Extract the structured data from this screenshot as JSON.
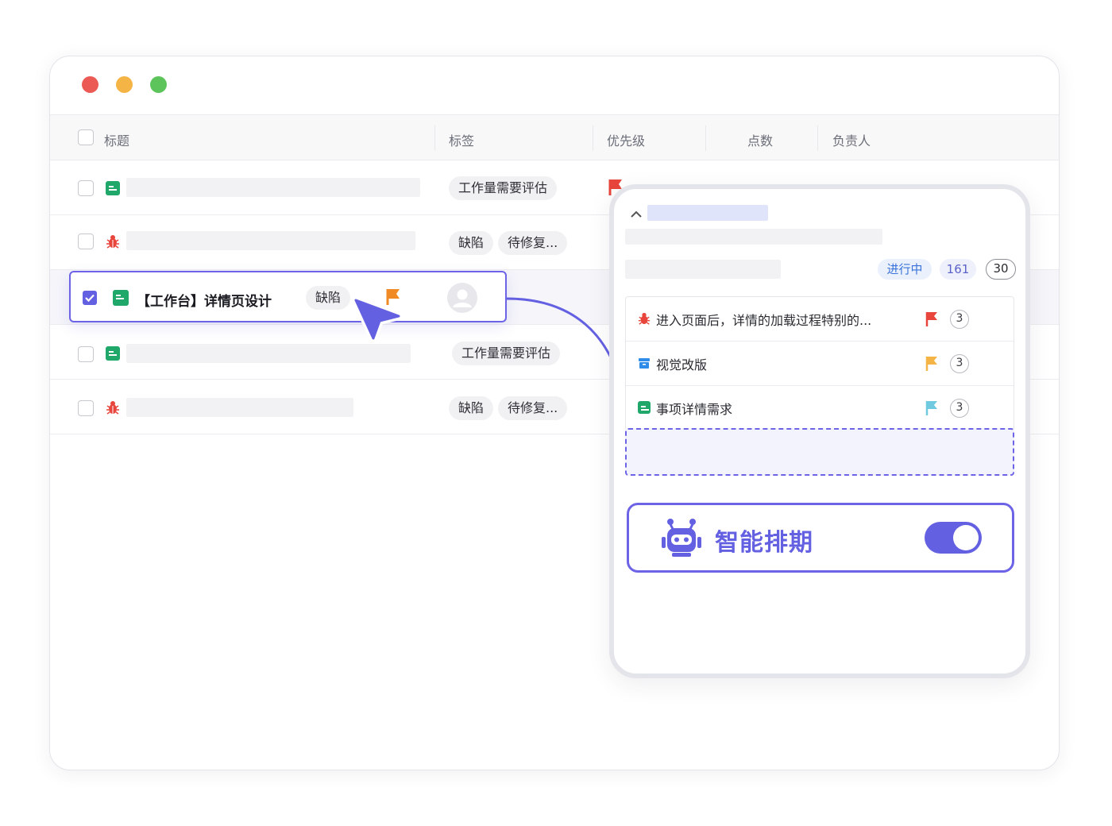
{
  "window": {
    "traffic_lights": [
      "#ec5a55",
      "#f5b546",
      "#5cc45a"
    ]
  },
  "table": {
    "columns": [
      "标题",
      "标签",
      "优先级",
      "点数",
      "负责人"
    ],
    "rows": [
      {
        "type": "doc",
        "tags": [
          "工作量需要评估"
        ]
      },
      {
        "type": "bug",
        "tags": [
          "缺陷",
          "待修复..."
        ]
      },
      {
        "type": "doc",
        "tags": [
          "工作量需要评估"
        ]
      },
      {
        "type": "bug",
        "tags": [
          "缺陷",
          "待修复..."
        ]
      }
    ]
  },
  "dragged_item": {
    "title": "【工作台】详情页设计",
    "tag": "缺陷",
    "flag_color": "#f08a24",
    "checked": true
  },
  "panel": {
    "status": "进行中",
    "count_a": "161",
    "count_b": "30",
    "items": [
      {
        "type": "bug",
        "text": "进入页面后，详情的加载过程特别的...",
        "flag_color": "#e8453c",
        "points": "3"
      },
      {
        "type": "box",
        "text": "视觉改版",
        "flag_color": "#f5b546",
        "points": "3"
      },
      {
        "type": "doc",
        "text": "事项详情需求",
        "flag_color": "#6fcadf",
        "points": "3"
      }
    ],
    "smart_schedule": {
      "label": "智能排期",
      "enabled": true
    }
  },
  "colors": {
    "accent": "#6460e2",
    "doc_green": "#1fa86a",
    "bug_red": "#e8453c",
    "box_blue": "#2f8ce8"
  }
}
